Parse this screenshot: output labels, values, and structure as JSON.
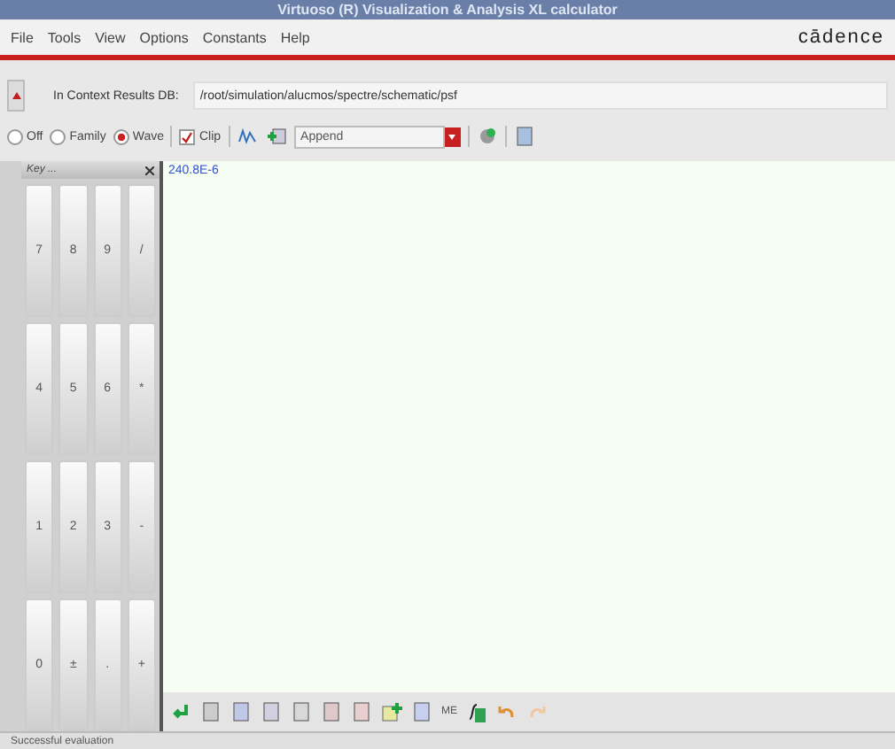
{
  "window": {
    "title": "Virtuoso (R) Visualization & Analysis XL calculator"
  },
  "menu": [
    "File",
    "Tools",
    "View",
    "Options",
    "Constants",
    "Help"
  ],
  "brand": "cādence",
  "context": {
    "label": "In Context Results DB:",
    "value": "/root/simulation/alucmos/spectre/schematic/psf"
  },
  "modes": [
    {
      "label": "Off",
      "selected": false
    },
    {
      "label": "Family",
      "selected": false
    },
    {
      "label": "Wave",
      "selected": true
    }
  ],
  "clip": {
    "label": "Clip",
    "checked": true
  },
  "append": {
    "value": "Append"
  },
  "keypad": {
    "title": "Key ...",
    "keys": [
      [
        "7",
        "8",
        "9",
        "/"
      ],
      [
        "4",
        "5",
        "6",
        "*"
      ],
      [
        "1",
        "2",
        "3",
        "-"
      ],
      [
        "0",
        "±",
        ".",
        "+"
      ]
    ]
  },
  "editor": {
    "value": "240.8E-6"
  },
  "bottom_toolbar": {
    "me_label": "ME"
  },
  "status_bar": "Successful evaluation"
}
